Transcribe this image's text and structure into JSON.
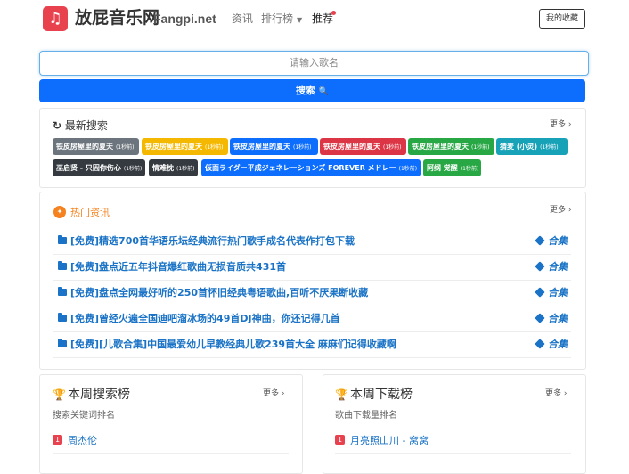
{
  "header": {
    "logo_glyph": "♫",
    "site_name": "放屁音乐网",
    "site_domain": "Fangpi.net",
    "nav": [
      {
        "label": "资讯"
      },
      {
        "label": "排行榜"
      },
      {
        "label": "推荐"
      }
    ],
    "caret": "▼",
    "favorite_label": "我的收藏"
  },
  "search": {
    "placeholder": "请输入歌名",
    "button_label": "搜索",
    "button_icon": "🔍"
  },
  "recent": {
    "title": "最新搜索",
    "icon": "↻",
    "more": "更多 ›",
    "tags": [
      {
        "text": "铁皮房屋里的夏天",
        "ago": "(1秒前)",
        "color": "#6c757d"
      },
      {
        "text": "铁皮房屋里的夏天",
        "ago": "(1秒前)",
        "color": "#f5b800"
      },
      {
        "text": "铁皮房屋里的夏天",
        "ago": "(1秒前)",
        "color": "#0d6efd"
      },
      {
        "text": "铁皮房屋里的夏天",
        "ago": "(1秒前)",
        "color": "#dc3545"
      },
      {
        "text": "铁皮房屋里的夏天",
        "ago": "(1秒前)",
        "color": "#28a745"
      },
      {
        "text": "猜麦 (小灵)",
        "ago": "(1秒前)",
        "color": "#17a2b8"
      },
      {
        "text": "巫启贤 - 只因你伤心",
        "ago": "(1秒前)",
        "color": "#343a40"
      },
      {
        "text": "情难枕",
        "ago": "(1秒前)",
        "color": "#343a40"
      },
      {
        "text": "仮面ライダー平成ジェネレーションズ FOREVER メドレー",
        "ago": "(1秒前)",
        "color": "#0d6efd"
      },
      {
        "text": "阿纲 觉醒",
        "ago": "(1秒前)",
        "color": "#28a745"
      }
    ]
  },
  "hot_news": {
    "title": "热门资讯",
    "more": "更多 ›",
    "collection_label": "合集",
    "items": [
      "[免费]精选700首华语乐坛经典流行热门歌手成名代表作打包下载",
      "[免费]盘点近五年抖音爆红歌曲无损音质共431首",
      "[免费]盘点全网最好听的250首怀旧经典粤语歌曲,百听不厌果断收藏",
      "[免费]曾经火遍全国迪吧溜冰场的49首DJ神曲，你还记得几首",
      "[免费][儿歌合集]中国最爱幼儿早教经典儿歌239首大全 麻麻们记得收藏啊"
    ]
  },
  "weekly_search": {
    "title": "本周搜索榜",
    "subtitle": "搜索关键词排名",
    "more": "更多 ›",
    "icon": "🏆",
    "items": [
      {
        "rank": "1",
        "name": "周杰伦"
      }
    ]
  },
  "weekly_download": {
    "title": "本周下载榜",
    "subtitle": "歌曲下载量排名",
    "more": "更多 ›",
    "icon": "🏆",
    "items": [
      {
        "rank": "1",
        "name": "月亮照山川 - 窝窝"
      }
    ]
  },
  "colors": {
    "brand": "#e8424f",
    "primary": "#0d6efd",
    "link": "#1a73c6"
  }
}
